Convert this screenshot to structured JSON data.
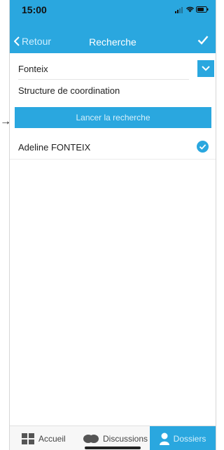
{
  "status": {
    "time": "15:00"
  },
  "nav": {
    "back_label": "Retour",
    "title": "Recherche"
  },
  "search": {
    "value": "Fonteix",
    "placeholder": ""
  },
  "structure_label": "Structure de coordination",
  "launch_label": "Lancer la recherche",
  "results": [
    {
      "name": "Adeline FONTEIX",
      "selected": true
    }
  ],
  "tabs": [
    {
      "label": "Accueil",
      "icon": "grid-icon",
      "active": false
    },
    {
      "label": "Discussions",
      "icon": "chat-bubbles-icon",
      "active": false
    },
    {
      "label": "Dossiers",
      "icon": "person-icon",
      "active": true
    }
  ],
  "colors": {
    "accent": "#2aa7df"
  }
}
